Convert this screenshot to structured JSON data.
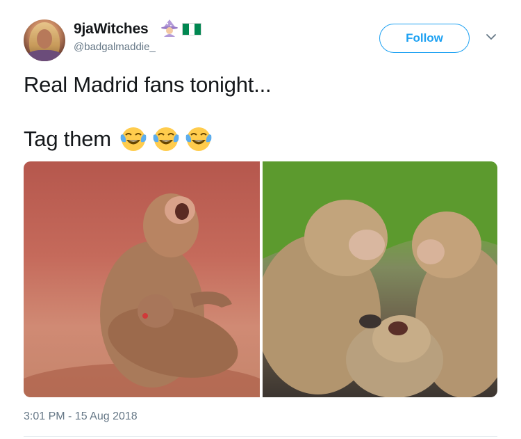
{
  "user": {
    "display_name": "9jaWitches",
    "handle": "@badgalmaddie_",
    "badges": [
      "woman-mage-icon",
      "nigeria-flag-icon"
    ],
    "flag_colors": [
      "#008751",
      "#ffffff",
      "#008751"
    ]
  },
  "actions": {
    "follow_label": "Follow",
    "more_icon": "chevron-down-icon"
  },
  "tweet": {
    "line1": "Real Madrid fans tonight...",
    "line2": "Tag them",
    "emojis": [
      "face-with-tears-of-joy",
      "face-with-tears-of-joy",
      "face-with-tears-of-joy"
    ]
  },
  "media": {
    "images": [
      {
        "name": "crying-monkey-holding-baby"
      },
      {
        "name": "monkeys-around-crying-monkey"
      }
    ]
  },
  "timestamp": "3:01 PM - 15 Aug 2018",
  "colors": {
    "accent": "#1da1f2",
    "text": "#14171a",
    "muted": "#657786"
  }
}
